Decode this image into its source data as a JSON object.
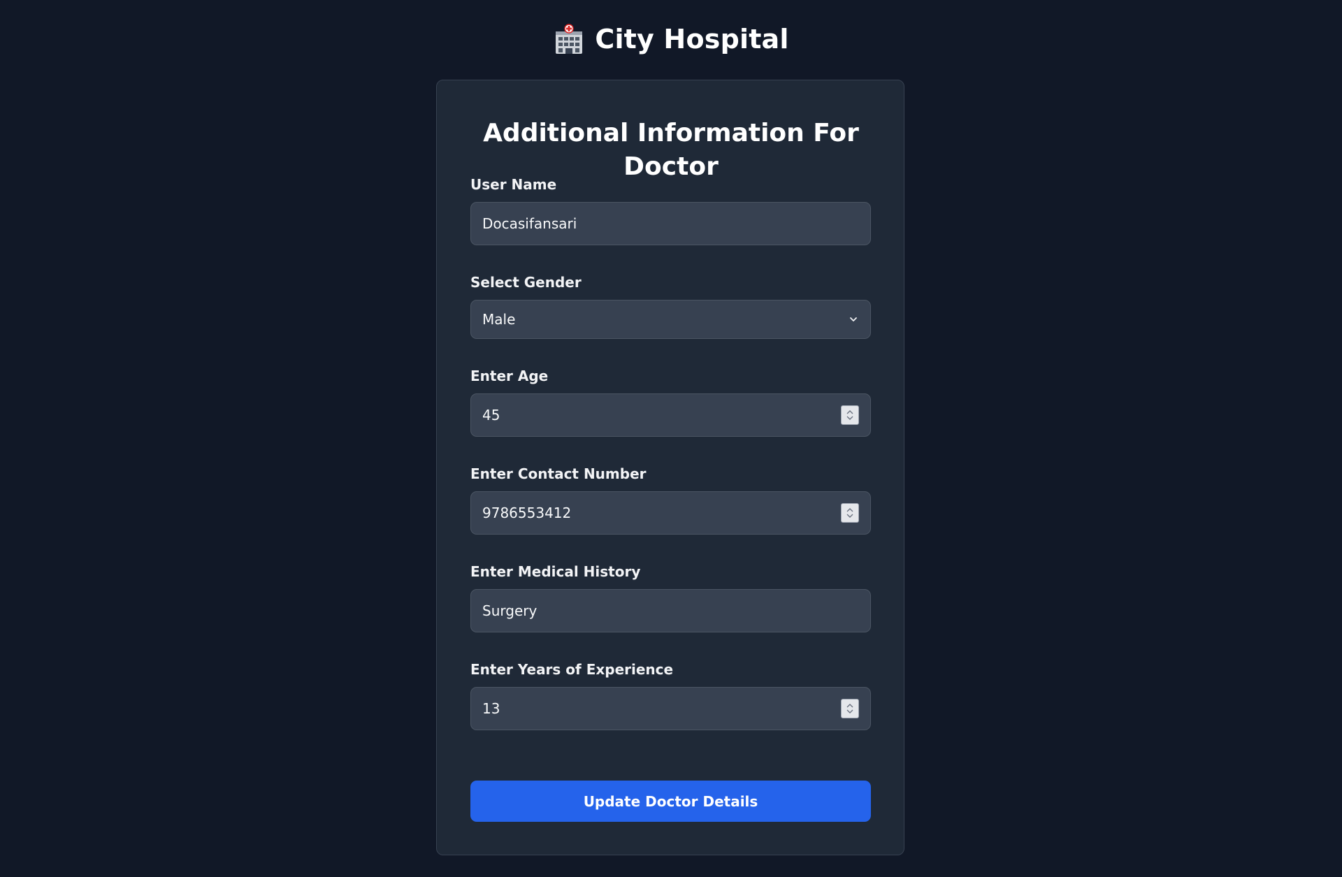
{
  "header": {
    "icon": "hospital-icon",
    "title": "City Hospital"
  },
  "form": {
    "title": "Additional Information For Doctor",
    "fields": {
      "username": {
        "label": "User Name",
        "value": "Docasifansari"
      },
      "gender": {
        "label": "Select Gender",
        "value": "Male",
        "icon": "chevron-down-icon"
      },
      "age": {
        "label": "Enter Age",
        "value": "45"
      },
      "contact": {
        "label": "Enter Contact Number",
        "value": "9786553412"
      },
      "medical_history": {
        "label": "Enter Medical History",
        "value": "Surgery"
      },
      "experience": {
        "label": "Enter Years of Experience",
        "value": "13"
      }
    },
    "submit_label": "Update Doctor Details"
  },
  "colors": {
    "page_background": "#111827",
    "card_background": "#1f2937",
    "input_background": "#374151",
    "accent": "#2563eb"
  }
}
